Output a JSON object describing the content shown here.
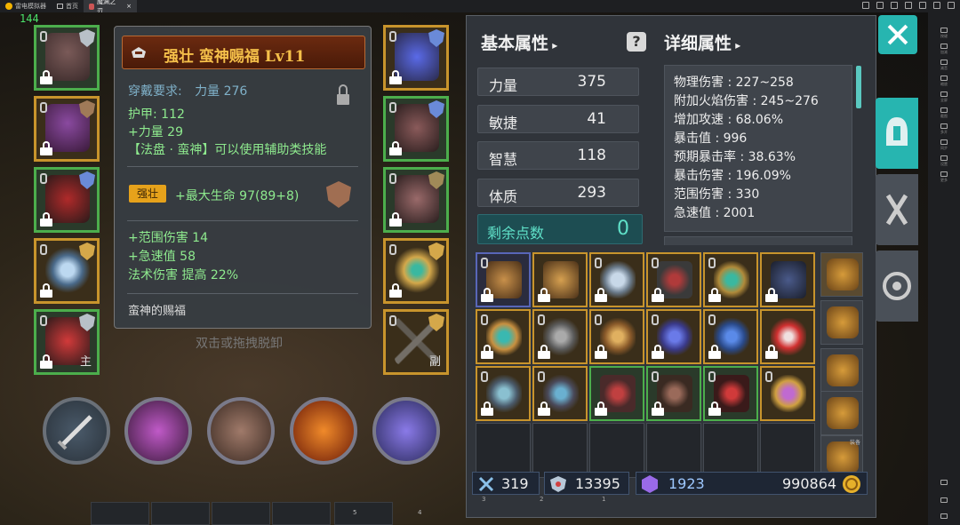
{
  "emulator": {
    "app_name": "雷电模拟器",
    "tabs": [
      {
        "label": "首页"
      },
      {
        "label": "魔渊之刃"
      }
    ],
    "sidebar_items": [
      "按键",
      "加减",
      "减音",
      "缩放",
      "全屏",
      "截图",
      "多开",
      "同步",
      "设置",
      "更多"
    ]
  },
  "fps": "144",
  "tooltip": {
    "title": "强壮  蛮神赐福  Lv11",
    "requirement_label": "穿戴要求:",
    "requirement_value": "力量  276",
    "armor": "护甲:  112",
    "strength": "+力量  29",
    "special": "【法盘 · 蛮神】可以使用辅助类技能",
    "badge": "强壮",
    "bonus": "+最大生命  97(89+8)",
    "aoe_damage": "+范围伤害  14",
    "haste": "+急速值  58",
    "spell_damage": "法术伤害  提高  22%",
    "flavor": "蛮神的赐福"
  },
  "hint": "双击或拖拽脱卸",
  "left_slots": [
    {
      "name": "helmet",
      "label": ""
    },
    {
      "name": "chest",
      "label": ""
    },
    {
      "name": "belt",
      "label": ""
    },
    {
      "name": "ring",
      "label": ""
    },
    {
      "name": "main-hand",
      "label": "主"
    }
  ],
  "right_slots": [
    {
      "name": "amulet",
      "label": ""
    },
    {
      "name": "gloves",
      "label": ""
    },
    {
      "name": "boots",
      "label": ""
    },
    {
      "name": "ring-2",
      "label": ""
    },
    {
      "name": "off-hand",
      "label": "副"
    }
  ],
  "basic_stats": {
    "header": "基本属性",
    "items": [
      {
        "name": "力量",
        "value": "375"
      },
      {
        "name": "敏捷",
        "value": "41"
      },
      {
        "name": "智慧",
        "value": "118"
      },
      {
        "name": "体质",
        "value": "293"
      }
    ],
    "remaining_label": "剩余点数",
    "remaining_value": "0"
  },
  "detail_stats": {
    "header": "详细属性",
    "rows": [
      "物理伤害 : 227~258",
      "附加火焰伤害 : 245~276",
      "增加攻速 : 68.06%",
      "暴击值 : 996",
      "预期暴击率 : 38.63%",
      "暴击伤害 : 196.09%",
      "范围伤害 : 330",
      "急速值 : 2001"
    ]
  },
  "currency": {
    "swords": "319",
    "swords_sub": "3",
    "shields": "13395",
    "shields_sub": "2",
    "shields_sub2": "1",
    "crystals": "1923",
    "gold": "990864"
  },
  "bag_col_label": "装备",
  "bottom_numbers": [
    "5",
    "4"
  ],
  "colors": {
    "accent": "#27b5b0",
    "gold_border": "#c8942c",
    "green_border": "#4cae4c",
    "blue_border": "#5866b8",
    "stat_green": "#8eea8e",
    "remaining": "#5fe0c8",
    "title_gold": "#f5c04a"
  }
}
